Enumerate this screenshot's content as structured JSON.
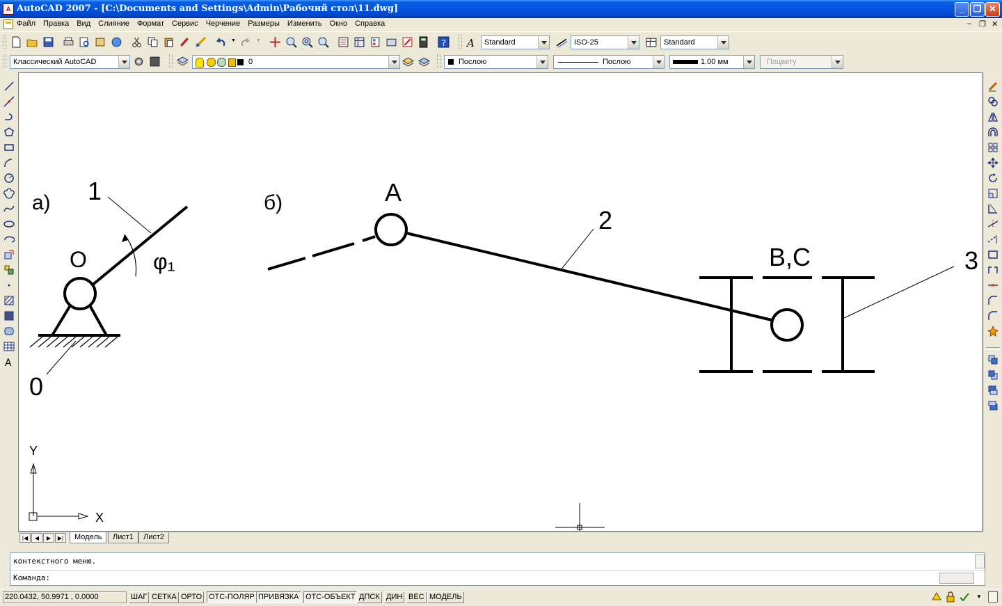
{
  "window": {
    "title": "AutoCAD 2007 - [C:\\Documents and Settings\\Admin\\Рабочий стол\\11.dwg]",
    "app_icon_text": "A"
  },
  "menu": [
    "Файл",
    "Правка",
    "Вид",
    "Слияние",
    "Формат",
    "Сервис",
    "Черчение",
    "Размеры",
    "Изменить",
    "Окно",
    "Справка"
  ],
  "styles_toolbar": {
    "text_style": "Standard",
    "dim_style": "ISO-25",
    "table_style": "Standard"
  },
  "properties_toolbar": {
    "workspace": "Классический AutoCAD",
    "layer": "0",
    "color": "Послою",
    "linetype": "Послою",
    "lineweight": "1.00 мм",
    "plot_style": "Поцвету"
  },
  "drawing": {
    "label_a": "а)",
    "label_b": "б)",
    "label_1": "1",
    "label_O": "O",
    "label_phi": "φ₁",
    "label_0": "0",
    "label_A": "A",
    "label_2": "2",
    "label_BC": "B,C",
    "label_3": "3",
    "ucs_x": "X",
    "ucs_y": "Y"
  },
  "layout_tabs": [
    "Модель",
    "Лист1",
    "Лист2"
  ],
  "command_line": {
    "history": "контекстного меню.",
    "prompt": "Команда:"
  },
  "status": {
    "coordinates": "220.0432, 50.9971 , 0.0000",
    "toggles": [
      {
        "label": "ШАГ",
        "on": false
      },
      {
        "label": "СЕТКА",
        "on": false
      },
      {
        "label": "ОРТО",
        "on": false
      },
      {
        "label": "ОТС-ПОЛЯР",
        "on": true
      },
      {
        "label": "ПРИВЯЗКА",
        "on": true
      },
      {
        "label": "ОТС-ОБЪЕКТ",
        "on": true
      },
      {
        "label": "ДПСК",
        "on": false
      },
      {
        "label": "ДИН",
        "on": false
      },
      {
        "label": "ВЕС",
        "on": false
      },
      {
        "label": "МОДЕЛЬ",
        "on": false
      }
    ]
  },
  "colors": {
    "titlebar": "#0054e3",
    "chrome": "#ece9d8",
    "canvas": "#ffffff"
  }
}
